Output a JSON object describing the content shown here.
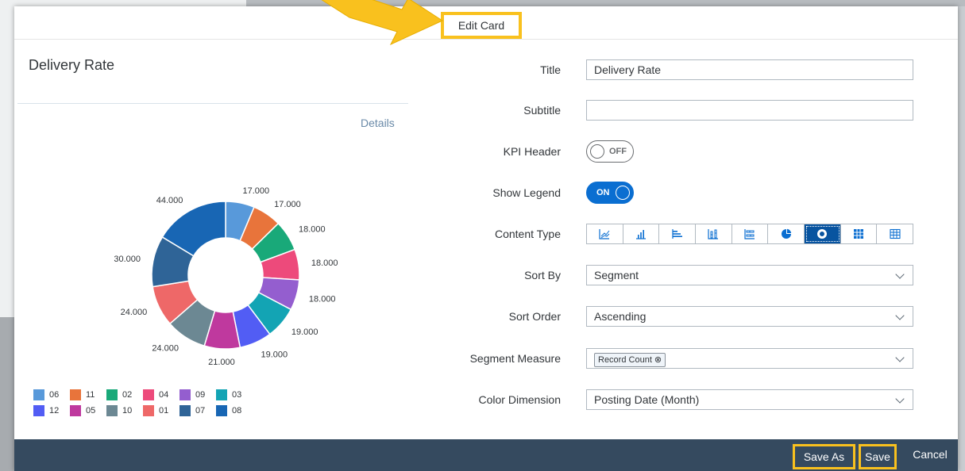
{
  "dialog": {
    "title": "Edit Card"
  },
  "card": {
    "title": "Delivery Rate",
    "details_link": "Details"
  },
  "chart_data": {
    "type": "pie",
    "donut": true,
    "slices": [
      {
        "label": "06",
        "value": 17.0,
        "display": "17.000",
        "color": "#5899da"
      },
      {
        "label": "11",
        "value": 17.0,
        "display": "17.000",
        "color": "#e8743b"
      },
      {
        "label": "02",
        "value": 18.0,
        "display": "18.000",
        "color": "#19a979"
      },
      {
        "label": "04",
        "value": 18.0,
        "display": "18.000",
        "color": "#ed4a7b"
      },
      {
        "label": "09",
        "value": 18.0,
        "display": "18.000",
        "color": "#945ecf"
      },
      {
        "label": "03",
        "value": 19.0,
        "display": "19.000",
        "color": "#13a4b4"
      },
      {
        "label": "12",
        "value": 19.0,
        "display": "19.000",
        "color": "#525df4"
      },
      {
        "label": "05",
        "value": 21.0,
        "display": "21.000",
        "color": "#bf399e"
      },
      {
        "label": "10",
        "value": 24.0,
        "display": "24.000",
        "color": "#6c8893"
      },
      {
        "label": "01",
        "value": 24.0,
        "display": "24.000",
        "color": "#ee6868"
      },
      {
        "label": "07",
        "value": 30.0,
        "display": "30.000",
        "color": "#2f6497"
      },
      {
        "label": "08",
        "value": 44.0,
        "display": "44.000",
        "color": "#1866b4"
      }
    ],
    "legend": [
      [
        "06",
        "11",
        "02",
        "04",
        "09",
        "03"
      ],
      [
        "12",
        "05",
        "10",
        "01",
        "07",
        "08"
      ]
    ],
    "legend_placement": "bottom-left"
  },
  "form": {
    "title": {
      "label": "Title",
      "value": "Delivery Rate"
    },
    "subtitle": {
      "label": "Subtitle",
      "value": ""
    },
    "kpi_header": {
      "label": "KPI Header",
      "state": "OFF"
    },
    "show_legend": {
      "label": "Show Legend",
      "state": "ON"
    },
    "content_type": {
      "label": "Content Type",
      "options": [
        "line-chart-icon",
        "column-chart-icon",
        "bar-chart-icon",
        "stacked-column-icon",
        "stacked-bar-icon",
        "pie-chart-icon",
        "donut-chart-icon",
        "heatmap-icon",
        "table-icon"
      ],
      "selected": "donut-chart-icon"
    },
    "sort_by": {
      "label": "Sort By",
      "value": "Segment"
    },
    "sort_order": {
      "label": "Sort Order",
      "value": "Ascending"
    },
    "segment_measure": {
      "label": "Segment Measure",
      "token": "Record Count"
    },
    "color_dimension": {
      "label": "Color Dimension",
      "value": "Posting Date (Month)"
    }
  },
  "footer": {
    "save_as": "Save As",
    "save": "Save",
    "cancel": "Cancel"
  },
  "colors": {
    "highlight": "#f9c11e",
    "footer_bg": "#354a5f",
    "accent": "#0a6ed1"
  }
}
